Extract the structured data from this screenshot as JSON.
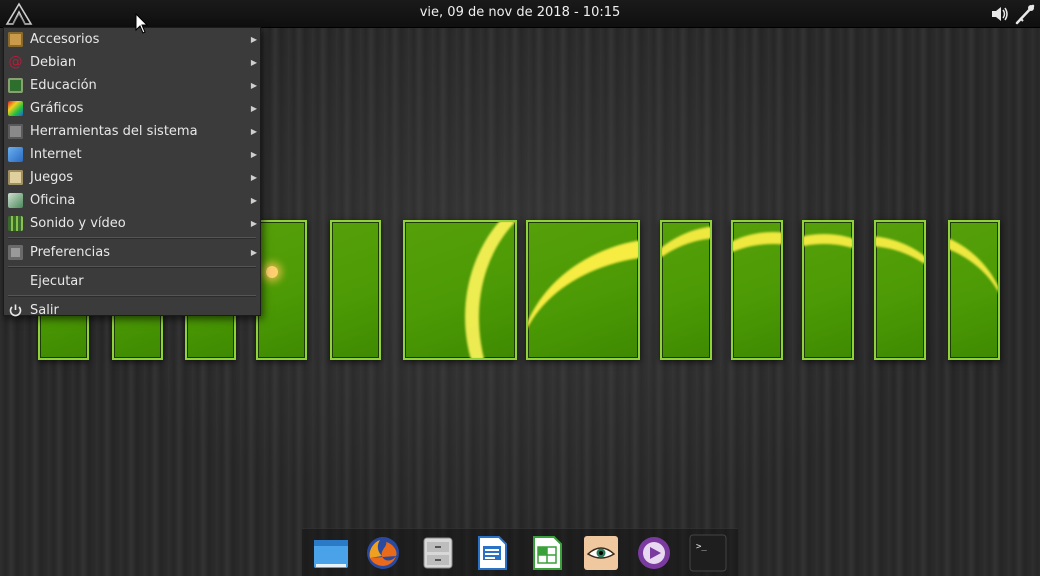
{
  "topbar": {
    "clock": "vie, 09 de nov de 2018 - 10:15",
    "launcher_icon": "lxde-fin-icon",
    "tray": [
      "volume-icon",
      "network-icon"
    ]
  },
  "menu": {
    "categories": [
      {
        "label": "Accesorios",
        "icon": "accessories-icon",
        "color": "#c89a4a"
      },
      {
        "label": "Debian",
        "icon": "debian-icon",
        "color": "#c0183a"
      },
      {
        "label": "Educación",
        "icon": "education-icon",
        "color": "#3c8b3a"
      },
      {
        "label": "Gráficos",
        "icon": "graphics-icon",
        "color": "#e8b020"
      },
      {
        "label": "Herramientas del sistema",
        "icon": "system-tools-icon",
        "color": "#9a9a9a"
      },
      {
        "label": "Internet",
        "icon": "internet-icon",
        "color": "#4a8fd8"
      },
      {
        "label": "Juegos",
        "icon": "games-icon",
        "color": "#d8c890"
      },
      {
        "label": "Oficina",
        "icon": "office-icon",
        "color": "#5a9a6a"
      },
      {
        "label": "Sonido y vídeo",
        "icon": "sound-video-icon",
        "color": "#6aa040"
      }
    ],
    "preferences": {
      "label": "Preferencias",
      "icon": "preferences-icon",
      "color": "#a0a0a0"
    },
    "run": {
      "label": "Ejecutar"
    },
    "logout": {
      "label": "Salir",
      "icon": "power-icon"
    }
  },
  "dock": {
    "items": [
      {
        "name": "file-manager-icon",
        "color": "#4aa3e8"
      },
      {
        "name": "firefox-icon",
        "color": "#e86a1a"
      },
      {
        "name": "archive-icon",
        "color": "#d8d8d8"
      },
      {
        "name": "writer-icon",
        "color": "#2a72c8"
      },
      {
        "name": "calc-icon",
        "color": "#3aa03a"
      },
      {
        "name": "eye-viewer-icon",
        "color": "#f0c8a0"
      },
      {
        "name": "media-player-icon",
        "color": "#7a3aa0"
      },
      {
        "name": "terminal-icon",
        "color": "#222222"
      }
    ]
  }
}
